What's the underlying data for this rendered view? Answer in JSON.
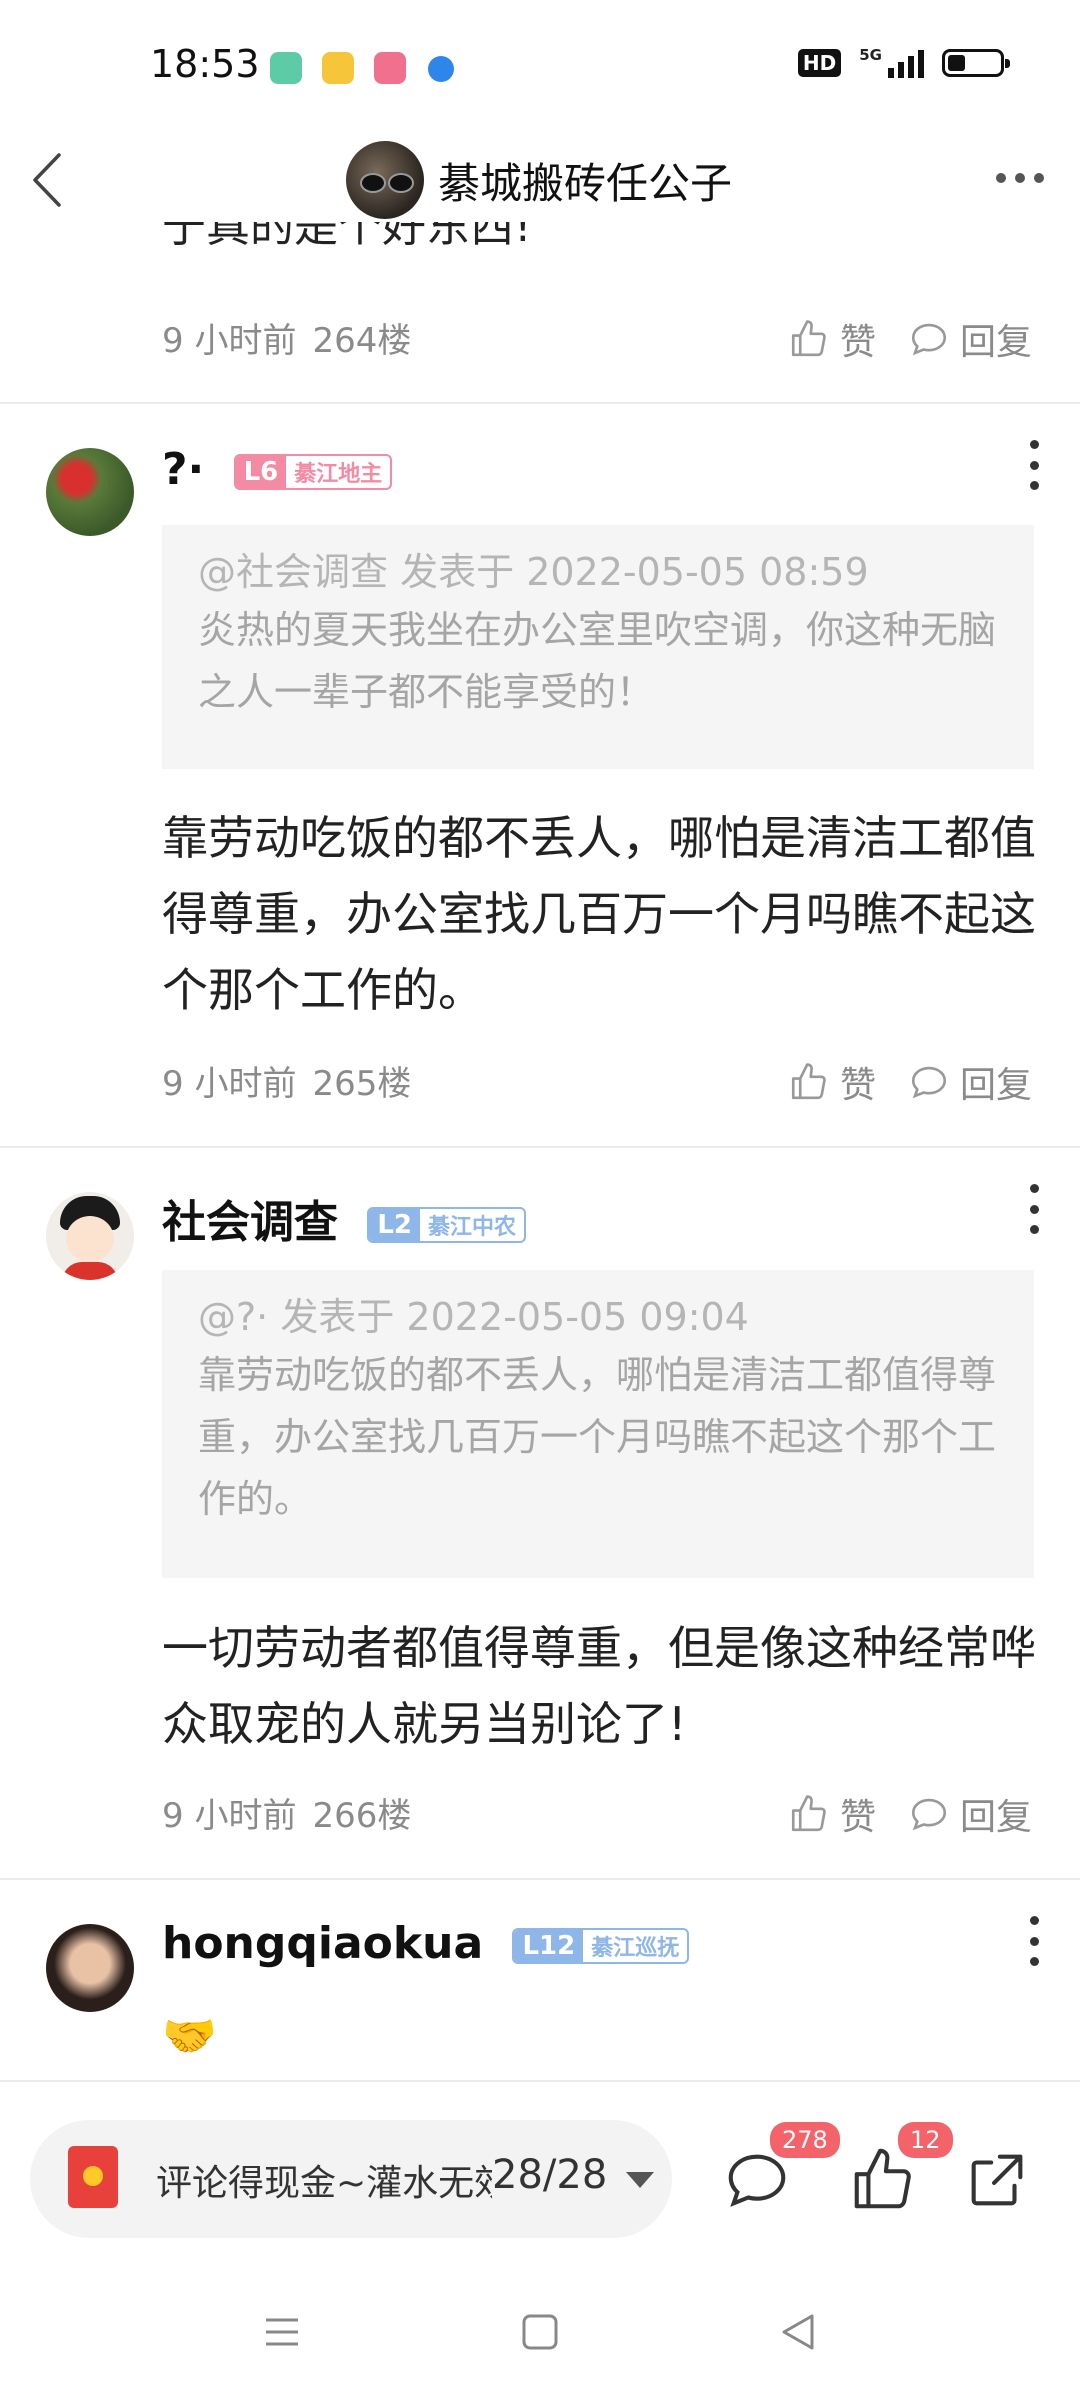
{
  "status_bar": {
    "time": "18:53",
    "hd": "HD",
    "network": "5G"
  },
  "header": {
    "title": "綦城搬砖任公子"
  },
  "clipped_prev_text": "于真的是个好东西!",
  "comments": [
    {
      "time": "9 小时前",
      "floor": "264楼",
      "like_label": "赞",
      "reply_label": "回复"
    },
    {
      "username": "?·",
      "level": "L6",
      "level_title": "綦江地主",
      "quote_author": "@社会调查",
      "quote_time": "发表于 2022-05-05 08:59",
      "quote_text": "炎热的夏天我坐在办公室里吹空调，你这种无脑之人一辈子都不能享受的！",
      "text": "靠劳动吃饭的都不丢人，哪怕是清洁工都值得尊重，办公室找几百万一个月吗瞧不起这个那个工作的。",
      "time": "9 小时前",
      "floor": "265楼",
      "like_label": "赞",
      "reply_label": "回复"
    },
    {
      "username": "社会调查",
      "level": "L2",
      "level_title": "綦江中农",
      "quote_author": "@?·",
      "quote_time": "发表于 2022-05-05 09:04",
      "quote_text": "靠劳动吃饭的都不丢人，哪怕是清洁工都值得尊重，办公室找几百万一个月吗瞧不起这个那个工作的。",
      "text": "一切劳动者都值得尊重，但是像这种经常哗众取宠的人就另当别论了!",
      "time": "9 小时前",
      "floor": "266楼",
      "like_label": "赞",
      "reply_label": "回复"
    },
    {
      "username": "hongqiaokua",
      "level": "L12",
      "level_title": "綦江巡抚",
      "text": "🤝"
    }
  ],
  "bottom_bar": {
    "placeholder": "评论得现金~灌水无效",
    "page": "28/28",
    "comment_count": "278",
    "like_count": "12"
  },
  "colors": {
    "accent_pink": "#f48aa4",
    "accent_blue": "#8fb6e8",
    "badge_red": "#f4626a"
  }
}
